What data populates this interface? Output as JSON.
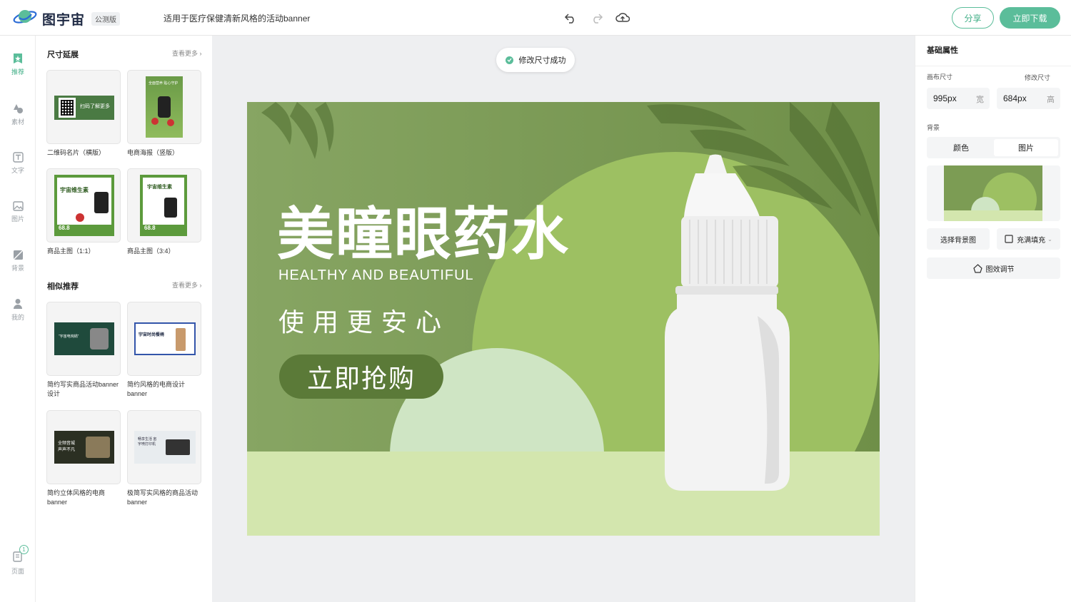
{
  "app": {
    "logo_text": "图宇宙",
    "beta_badge": "公测版",
    "doc_title": "适用于医疗保健清新风格的活动banner"
  },
  "toolbar": {
    "share_label": "分享",
    "download_label": "立即下载"
  },
  "rail": {
    "items": [
      "推荐",
      "素材",
      "文字",
      "图片",
      "背景",
      "我的"
    ],
    "page_label": "页面",
    "page_count": "1"
  },
  "panel": {
    "size_section": {
      "title": "尺寸延展",
      "more": "查看更多",
      "items": [
        {
          "label": "二维码名片（横版）",
          "thumb_text": "扫码了解更多"
        },
        {
          "label": "电商海报（竖版）",
          "thumb_text": "全面营养 贴心守护"
        },
        {
          "label": "商品主图（1:1）",
          "thumb_text": "宇宙维生素",
          "price": "68.8"
        },
        {
          "label": "商品主图（3:4）",
          "thumb_text": "宇宙维生素",
          "price": "68.8"
        }
      ]
    },
    "similar_section": {
      "title": "相似推荐",
      "more": "查看更多",
      "items": [
        {
          "label": "简约写实商品活动banner设计",
          "thumb_text": "“宇宙电炖锅”"
        },
        {
          "label": "简约风格的电商设计banner",
          "thumb_text": "宇宙时尚餐椅"
        },
        {
          "label": "简约立体风格的电商banner",
          "thumb_text": "全频音城 声声不凡"
        },
        {
          "label": "极简写实风格的商品活动banner",
          "thumb_text": "畅享生活 宙宇喷打印机"
        }
      ]
    }
  },
  "canvas": {
    "toast": "修改尺寸成功",
    "title": "美瞳眼药水",
    "subtitle_en": "HEALTHY AND BEAUTIFUL",
    "slogan": "使用更安心",
    "cta": "立即抢购"
  },
  "props": {
    "section_title": "基础属性",
    "canvas_size_label": "画布尺寸",
    "modify_size_label": "修改尺寸",
    "width_value": "995px",
    "width_unit": "宽",
    "height_value": "684px",
    "height_unit": "高",
    "background_label": "背景",
    "bg_tabs": [
      "颜色",
      "图片"
    ],
    "choose_bg_label": "选择背景图",
    "fill_label": "充满填充",
    "effect_label": "图效调节"
  },
  "colors": {
    "accent": "#5bbd9a",
    "banner_dark": "#5d7a3a",
    "banner_light": "#d3e6ae"
  }
}
